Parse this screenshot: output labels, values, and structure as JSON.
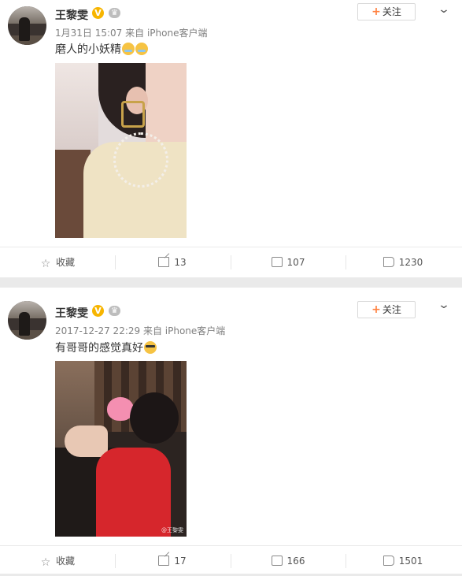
{
  "posts": [
    {
      "author": "王黎雯",
      "verified_badge": "V",
      "timestamp": "1月31日 15:07",
      "source": "来自 iPhone客户端",
      "text": "磨人的小妖精",
      "emoji": "crying-laughing-emoji",
      "follow_label": "关注",
      "image_watermark": "",
      "actions": {
        "favorite": "收藏",
        "repost": "13",
        "comment": "107",
        "like": "1230"
      }
    },
    {
      "author": "王黎雯",
      "verified_badge": "V",
      "timestamp": "2017-12-27 22:29",
      "source": "来自 iPhone客户端",
      "text": "有哥哥的感觉真好",
      "emoji": "cool-sunglasses-emoji",
      "follow_label": "关注",
      "image_watermark": "@王黎雯",
      "actions": {
        "favorite": "收藏",
        "repost": "17",
        "comment": "166",
        "like": "1501"
      }
    }
  ],
  "colors": {
    "follow_plus": "#ff8140",
    "verified": "#f7b500",
    "background": "#eaeaea"
  },
  "icons": {
    "follow": "plus-icon",
    "more": "chevron-down-icon",
    "favorite": "star-icon",
    "repost": "share-box-icon",
    "comment": "comment-icon",
    "like": "thumb-up-icon"
  }
}
